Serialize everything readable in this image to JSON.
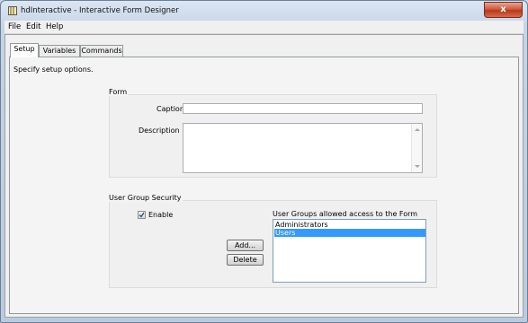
{
  "window": {
    "title": "hdInteractive - Interactive Form Designer",
    "close_glyph": "x"
  },
  "menu": {
    "items": [
      {
        "label": "File"
      },
      {
        "label": "Edit"
      },
      {
        "label": "Help"
      }
    ]
  },
  "tabs": [
    {
      "label": "Setup",
      "active": true
    },
    {
      "label": "Variables",
      "active": false
    },
    {
      "label": "Commands",
      "active": false
    }
  ],
  "setup": {
    "hint": "Specify setup options.",
    "form_group": {
      "title": "Form",
      "caption_label": "Caption",
      "caption_value": "",
      "description_label": "Description",
      "description_value": ""
    },
    "security_group": {
      "title": "User Group Security",
      "enable_label": "Enable",
      "enable_checked": true,
      "allowed_label": "User Groups allowed access to the Form",
      "add_label": "Add...",
      "delete_label": "Delete",
      "groups": [
        {
          "name": "Administrators",
          "selected": false
        },
        {
          "name": "Users",
          "selected": true
        }
      ]
    }
  },
  "icons": {
    "app": "form-designer-icon",
    "check": "checkmark-icon",
    "scroll_up": "scroll-up-arrow-icon",
    "scroll_down": "scroll-down-arrow-icon"
  },
  "colors": {
    "selection": "#3399ff",
    "close_button": "#c9492b"
  }
}
